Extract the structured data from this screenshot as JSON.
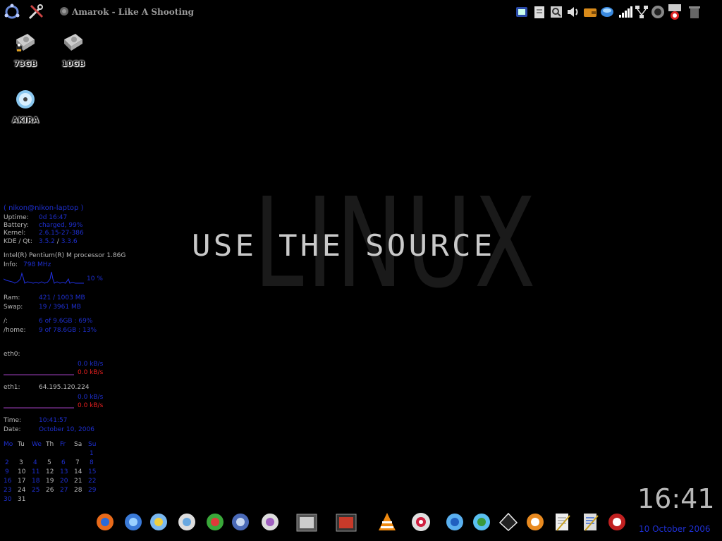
{
  "taskbar": {
    "task_title": "Amarok - Like A Shooting Star by I",
    "launcher_icons": [
      "kde-menu-icon",
      "settings-tools-icon"
    ]
  },
  "tray_icons": [
    "bluetooth-icon",
    "clipboard-icon",
    "search-icon",
    "volume-icon",
    "wallet-icon",
    "network-globe-icon",
    "signal-strength-icon",
    "network-icon",
    "display-icon",
    "lock-icon",
    "trash-icon"
  ],
  "desktop_icons": [
    {
      "name": "hdd-linux",
      "label": "73GB"
    },
    {
      "name": "hdd",
      "label": "10GB"
    },
    {
      "name": "cdrom",
      "label": "AKIRA"
    }
  ],
  "wallpaper": {
    "big_text": "LINUX",
    "tagline": "USE THE SOURCE"
  },
  "conky": {
    "user_host": "( nikon@nikon-laptop )",
    "uptime_label": "Uptime:",
    "uptime": "0d 16:47",
    "battery_label": "Battery:",
    "battery": "charged, 99%",
    "kernel_label": "Kernel:",
    "kernel": "2.6.15-27-386",
    "kdeqt_label": "KDE / Qt:",
    "kde_version": "3.5.2",
    "qt_separator": "/",
    "qt_version": "3.3.6",
    "cpu": "Intel(R) Pentium(R) M processor 1.86G",
    "info_label": "Info:",
    "cpu_freq": "798 MHz",
    "cpu_usage": "10 %",
    "ram_label": "Ram:",
    "ram": "421 / 1003 MB",
    "swap_label": "Swap:",
    "swap": "19 / 3961 MB",
    "root_label": "/:",
    "root_fs": "6 of 9.6GB : 69%",
    "home_label": "/home:",
    "home_fs": "9 of 78.6GB : 13%",
    "eth0_label": "eth0:",
    "eth0_down": "0.0 kB/s",
    "eth0_up": "0.0 kB/s",
    "eth1_label": "eth1:",
    "eth1_ip": "64.195.120.224",
    "eth1_down": "0.0 kB/s",
    "eth1_up": "0.0 kB/s",
    "time_label": "Time:",
    "time": "10:41:57",
    "date_label": "Date:",
    "date": "October 10, 2006"
  },
  "calendar": {
    "headers": [
      "Mo",
      "Tu",
      "We",
      "Th",
      "Fr",
      "Sa",
      "Su"
    ],
    "weeks": [
      [
        "",
        "",
        "",
        "",
        "",
        "",
        "1"
      ],
      [
        "2",
        "3",
        "4",
        "5",
        "6",
        "7",
        "8"
      ],
      [
        "9",
        "10",
        "11",
        "12",
        "13",
        "14",
        "15"
      ],
      [
        "16",
        "17",
        "18",
        "19",
        "20",
        "21",
        "22"
      ],
      [
        "23",
        "24",
        "25",
        "26",
        "27",
        "28",
        "29"
      ],
      [
        "30",
        "31",
        "",
        "",
        "",
        "",
        ""
      ]
    ]
  },
  "clock": {
    "time": "16:41",
    "date": "10 October 2006"
  },
  "dock_icons": [
    "firefox-icon",
    "web-browser-icon",
    "kopete-icon",
    "gaim-chat-icon",
    "file-sharing-icon",
    "thunderbird-icon",
    "game-controller-icon",
    "kde-control-icon",
    "film-clapper-icon",
    "vlc-icon",
    "cd-burner-icon",
    "kde-edu-icon",
    "image-viewer-icon",
    "inkscape-icon",
    "amarok-icon",
    "notes-icon",
    "text-editor-icon",
    "k3b-icon"
  ],
  "colors": {
    "accent_blue": "#1e2fd0",
    "accent_red": "#e82020",
    "graph_blue": "#2030e0",
    "graph_purple": "#a040c0"
  }
}
